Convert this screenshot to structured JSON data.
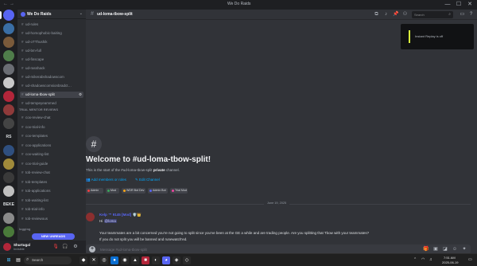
{
  "window": {
    "title": "We Do Raids",
    "nav_back": "←",
    "nav_forward": "→",
    "minimize": "—",
    "maximize": "☐",
    "close": "✕"
  },
  "rail": {
    "text_servers": [
      "RS",
      "BEKE"
    ]
  },
  "guild": {
    "name": "We Do Raids",
    "chevron": "⌄"
  },
  "channels_top": [
    {
      "name": "ud-rules"
    },
    {
      "name": "ud-homophobic-baiting"
    },
    {
      "name": "ud-oTThushik"
    },
    {
      "name": "ud-bm-full"
    },
    {
      "name": "ud-finscape"
    },
    {
      "name": "ud-rasshack"
    },
    {
      "name": "ud-mikerabshadowscom"
    },
    {
      "name": "ud-shadowscomsionbradct…"
    },
    {
      "name": "ud-loma-tbow-split",
      "active": true
    },
    {
      "name": "ud-tempeyeammed"
    }
  ],
  "category_trial": "TRIAL MENTOR REVIEWS",
  "channels_trial": [
    {
      "name": "cox-review-chat"
    },
    {
      "name": "cox-trial-info"
    },
    {
      "name": "cox-templates"
    },
    {
      "name": "cox-applications"
    },
    {
      "name": "cox-waiting-list"
    },
    {
      "name": "cox-trial-guide"
    },
    {
      "name": "tob-review-chat"
    },
    {
      "name": "tob-templates"
    },
    {
      "name": "tob-applications"
    },
    {
      "name": "tob-waiting-list"
    },
    {
      "name": "tob-trial-info"
    },
    {
      "name": "tob-reviewous"
    }
  ],
  "category_logging": "logging",
  "new_unreads": "NEW UNREADS",
  "user": {
    "name": "Shurtugal",
    "status": "Invisible"
  },
  "header": {
    "channel": "ud-loma-tbow-split",
    "search_placeholder": "Search"
  },
  "activity": {
    "text": "Instant Replay is off"
  },
  "welcome": {
    "icon": "#",
    "title": "Welcome to #ud-loma-tbow-split!",
    "sub_prefix": "This is the start of the #ud-loma-tbow-split",
    "sub_private": "private",
    "sub_suffix": "channel.",
    "add_members": "Add members or roles",
    "edit_channel": "Edit Channel",
    "roles": [
      {
        "label": "Admin",
        "color": "#f23f42"
      },
      {
        "label": "Mod",
        "color": "#3ba55c"
      },
      {
        "label": "WDR Bot Dev",
        "color": "#faa61a"
      },
      {
        "label": "Admin Bot",
        "color": "#5865f2"
      },
      {
        "label": "Trial Mod",
        "color": "#eb459e"
      }
    ]
  },
  "divider_date": "June 19, 2025",
  "message": {
    "author": "Kelp ™ 9145 [Mod] 🛡️👑",
    "line1_prefix": "Hi",
    "line1_mention": "@loma",
    "line2": "Your teammates are a bit concerned you're not going to split since you've been at the GE a while and are trading people. Are you splitting that Tbow with your teammates?",
    "line3": "If you do not split you will be banned and runewatch'ed."
  },
  "composer": {
    "placeholder": "Message #ud-loma-tbow-split",
    "plus": "+"
  },
  "taskbar": {
    "search": "Search",
    "time": "7:51 AM",
    "date": "2025-06-19"
  }
}
